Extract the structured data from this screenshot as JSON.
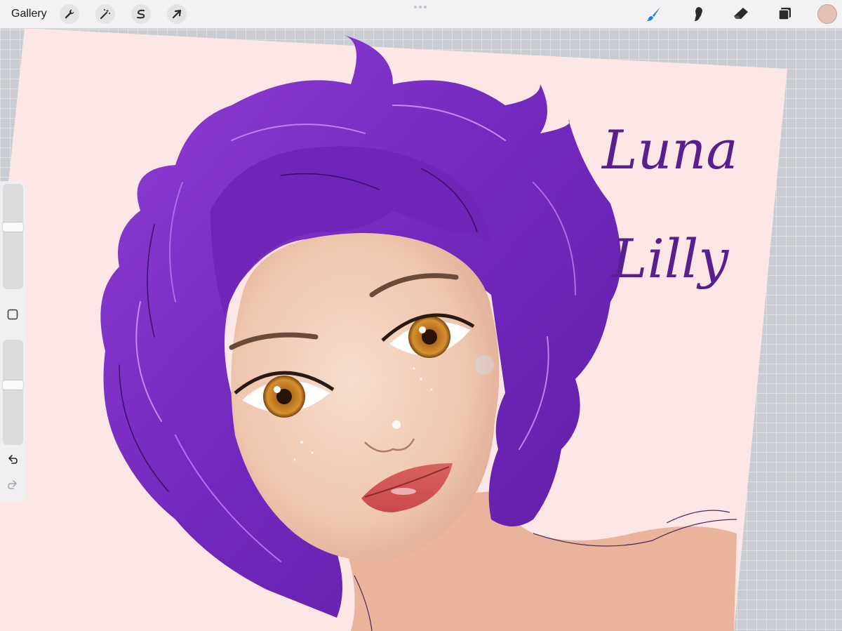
{
  "toolbar": {
    "gallery_label": "Gallery",
    "left_tools": [
      {
        "name": "actions",
        "icon": "wrench-icon"
      },
      {
        "name": "adjustments",
        "icon": "magic-wand-icon"
      },
      {
        "name": "selection",
        "icon": "selection-s-icon"
      },
      {
        "name": "transform",
        "icon": "arrow-cursor-icon"
      }
    ],
    "right_tools": [
      {
        "name": "brush",
        "icon": "brush-icon",
        "active": true
      },
      {
        "name": "smudge",
        "icon": "smudge-finger-icon"
      },
      {
        "name": "eraser",
        "icon": "eraser-icon"
      },
      {
        "name": "layers",
        "icon": "layers-icon"
      }
    ],
    "active_color": "#e6c0b4",
    "accent_color": "#1c7cf0"
  },
  "sidebar": {
    "brush_size_level": 0.6,
    "opacity_level": 0.58
  },
  "artwork": {
    "signature_line1": "Luna",
    "signature_line2": "Lilly",
    "background_color": "#fde6e6",
    "hair_color": "#7a2fc2",
    "skin_color": "#f0cdb8",
    "ink_color": "#5a1f8f"
  }
}
